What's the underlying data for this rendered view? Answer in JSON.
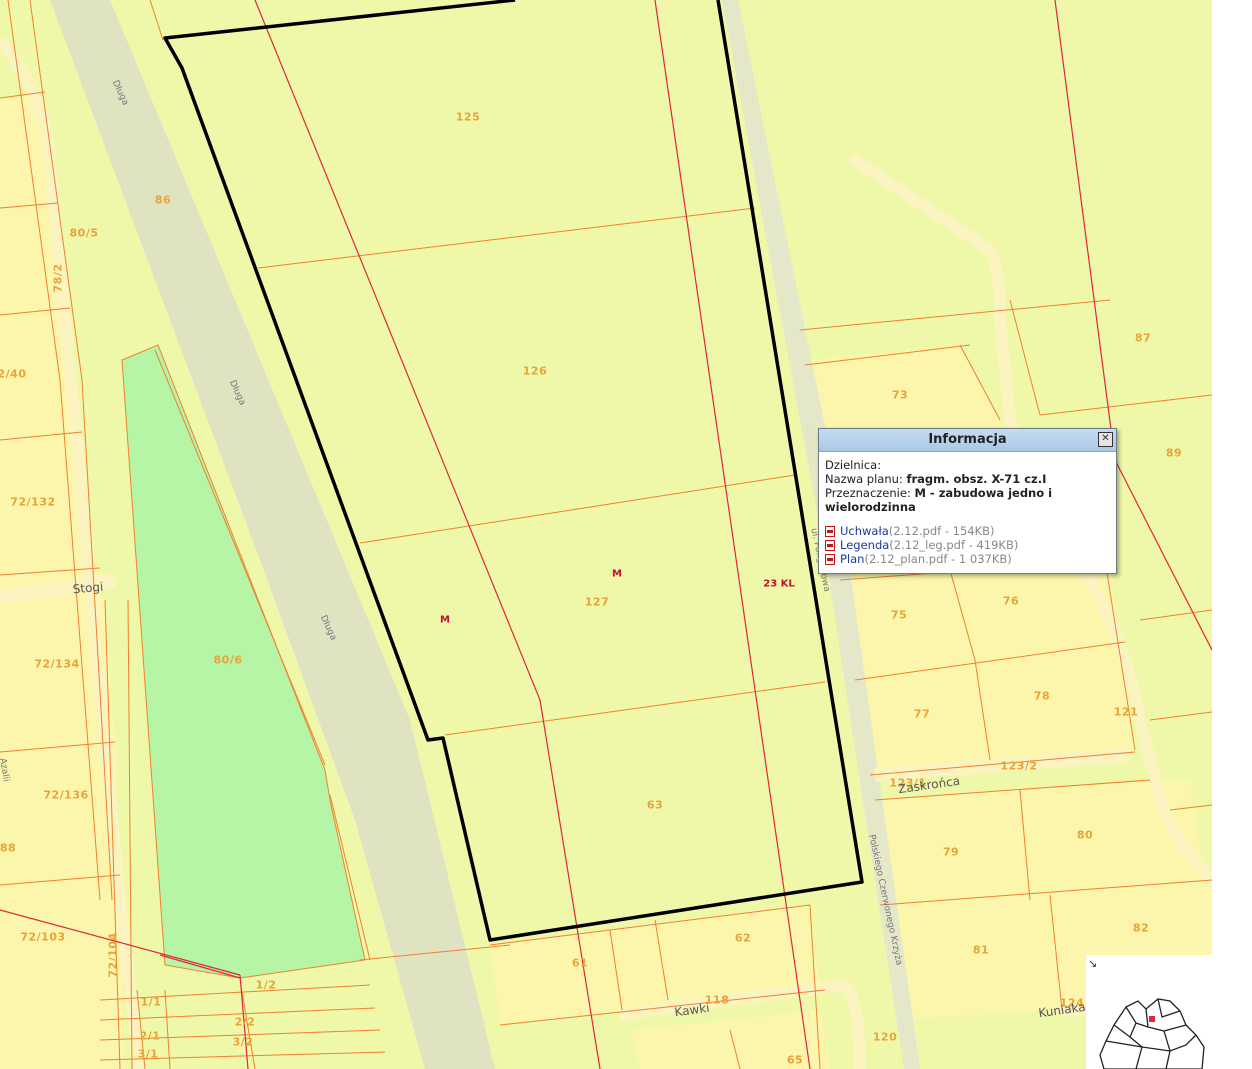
{
  "popup": {
    "title": "Informacja",
    "district_label": "Dzielnica:",
    "plan_name_label": "Nazwa planu:",
    "plan_name_value": "fragm. obsz. X-71 cz.I",
    "purpose_label": "Przeznaczenie:",
    "purpose_value": "M - zabudowa jedno i wielorodzinna",
    "files": [
      {
        "label": "Uchwała",
        "meta": "(2.12.pdf - 154KB)"
      },
      {
        "label": "Legenda",
        "meta": "(2.12_leg.pdf - 419KB)"
      },
      {
        "label": "Plan",
        "meta": "(2.12_plan.pdf - 1 037KB)"
      }
    ],
    "close_icon": "close-icon"
  },
  "parcels": [
    "125",
    "126",
    "127",
    "63",
    "62",
    "61",
    "86",
    "80/5",
    "78/2",
    "2/40",
    "72/132",
    "72/134",
    "72/136",
    "80/6",
    "72/103",
    "72/104",
    "88",
    "87",
    "89",
    "73",
    "75",
    "76",
    "77",
    "78",
    "79",
    "80",
    "81",
    "82",
    "121",
    "123/1",
    "123/2",
    "118",
    "124",
    "120",
    "65",
    "1/1",
    "1/2",
    "2/1",
    "2/2",
    "3/1",
    "3/2"
  ],
  "zones": [
    "M",
    "M",
    "23 KL"
  ],
  "streets": {
    "dluga": "Długa",
    "stogi": "Stogi",
    "zaskronca": "Zaskrońca",
    "kawki": "Kawki",
    "kuniaka": "Kuniaka",
    "side_street": "ul. Poligonowa",
    "left_street": "Azalii",
    "right_vertical": "Polskiego Czerwonego Krzyża"
  },
  "colors": {
    "map_bg": "#eef8a8",
    "residential": "#fbf6ab",
    "greenery": "#b5f5a5",
    "road": "#dfe3c2",
    "parcel_line": "#f08030",
    "plan_line": "#e0283a",
    "plan_boundary": "#000000",
    "parcel_label": "#e8a33b",
    "zone_label": "#c4102c"
  }
}
